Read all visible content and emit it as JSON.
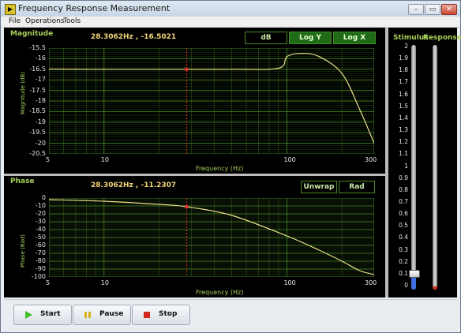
{
  "window": {
    "title": "Frequency Response Measurement",
    "app_icon_glyph": "▶",
    "min_glyph": "–",
    "max_glyph": "▭",
    "close_glyph": "✕"
  },
  "menu": [
    "File",
    "Operations",
    "Tools"
  ],
  "magnitude": {
    "label": "Magnitude",
    "readout_freq": "28.3062Hz",
    "readout_sep": ",",
    "readout_val": "-16.5021",
    "btn_db": "dB",
    "btn_logy": "Log Y",
    "btn_logx": "Log X",
    "ylabel": "Magnitude (dB)",
    "xlabel": "Frequency (Hz)",
    "yticks": [
      "-15.5",
      "-16",
      "-16.5",
      "-17",
      "-17.5",
      "-18",
      "-18.5",
      "-19",
      "-19.5",
      "-20",
      "-20.5"
    ],
    "xticks": [
      "5",
      "10",
      "100",
      "300"
    ]
  },
  "phase": {
    "label": "Phase",
    "readout_freq": "28.3062Hz",
    "readout_sep": ",",
    "readout_val": "-11.2307",
    "btn_unwrap": "Unwrap",
    "btn_rad": "Rad",
    "ylabel": "Phase (Rad)",
    "xlabel": "Frequency (Hz)",
    "yticks": [
      "0",
      "-10",
      "-20",
      "-30",
      "-40",
      "-50",
      "-60",
      "-70",
      "-80",
      "-90",
      "-100"
    ],
    "xticks": [
      "5",
      "10",
      "100",
      "300"
    ]
  },
  "side": {
    "stimulus_label": "Stimulus",
    "response_label": "Response",
    "scale": [
      "2",
      "1.9",
      "1.8",
      "1.7",
      "1.6",
      "1.5",
      "1.4",
      "1.3",
      "1.2",
      "1.1",
      "1",
      "0.9",
      "0.8",
      "0.7",
      "0.6",
      "0.5",
      "0.4",
      "0.3",
      "0.2",
      "0.1",
      "0"
    ],
    "stimulus_level": 0.1,
    "response_level": 0
  },
  "controls": {
    "start": "Start",
    "pause": "Pause",
    "stop": "Stop"
  },
  "colors": {
    "accent_green": "#a7d05a",
    "trace": "#e9e08a",
    "cursor": "#e0302a",
    "grid": "#2f5a1a",
    "plot_bg": "#000000"
  },
  "chart_data": [
    {
      "type": "line",
      "xlabel": "Frequency (Hz)",
      "ylabel": "Magnitude (dB)",
      "xscale": "log",
      "xlim": [
        5,
        300
      ],
      "ylim": [
        -20.5,
        -15.5
      ],
      "grid": true,
      "x": [
        5,
        10,
        20,
        28.3,
        50,
        90,
        100,
        120,
        150,
        200,
        250,
        300
      ],
      "values": [
        -16.49,
        -16.5,
        -16.5,
        -16.5,
        -16.5,
        -16.45,
        -15.9,
        -15.75,
        -15.9,
        -16.7,
        -18.4,
        -20.0
      ],
      "cursor_x": 28.3062
    },
    {
      "type": "line",
      "xlabel": "Frequency (Hz)",
      "ylabel": "Phase (Rad)",
      "xscale": "log",
      "xlim": [
        5,
        300
      ],
      "ylim": [
        -100,
        0
      ],
      "grid": true,
      "x": [
        5,
        10,
        20,
        28.3,
        50,
        100,
        150,
        200,
        250,
        300
      ],
      "values": [
        -2,
        -4,
        -8,
        -11,
        -22,
        -48,
        -66,
        -80,
        -92,
        -97
      ],
      "cursor_x": 28.3062
    }
  ]
}
